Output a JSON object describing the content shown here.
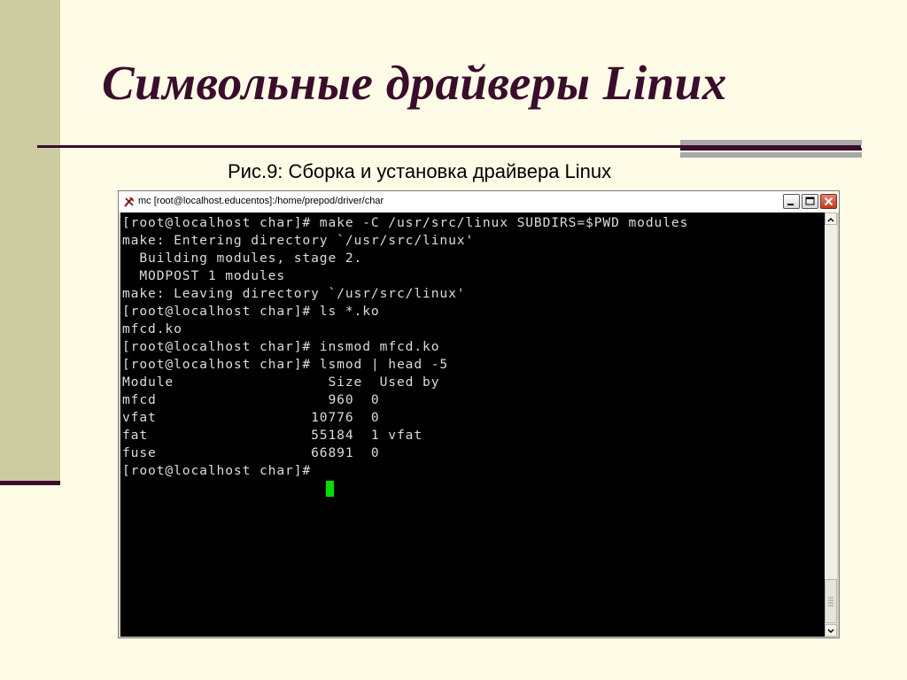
{
  "slide": {
    "title": "Символьные драйверы Linux",
    "caption": "Рис.9: Сборка и установка драйвера Linux"
  },
  "window": {
    "title": "mc [root@localhost.educentos]:/home/prepod/driver/char",
    "icon": "mc-app-icon"
  },
  "terminal": {
    "lines": [
      "[root@localhost char]# make -C /usr/src/linux SUBDIRS=$PWD modules",
      "make: Entering directory `/usr/src/linux'",
      "  Building modules, stage 2.",
      "  MODPOST 1 modules",
      "make: Leaving directory `/usr/src/linux'",
      "[root@localhost char]# ls *.ko",
      "mfcd.ko",
      "[root@localhost char]# insmod mfcd.ko",
      "[root@localhost char]# lsmod | head -5",
      "Module                  Size  Used by",
      "mfcd                    960  0",
      "vfat                  10776  0",
      "fat                   55184  1 vfat",
      "fuse                  66891  0",
      "[root@localhost char]# "
    ],
    "cursor_color": "#00E000"
  },
  "colors": {
    "accent": "#3A0D2C",
    "background": "#FEFCE6",
    "band": "#CDCBA0"
  }
}
